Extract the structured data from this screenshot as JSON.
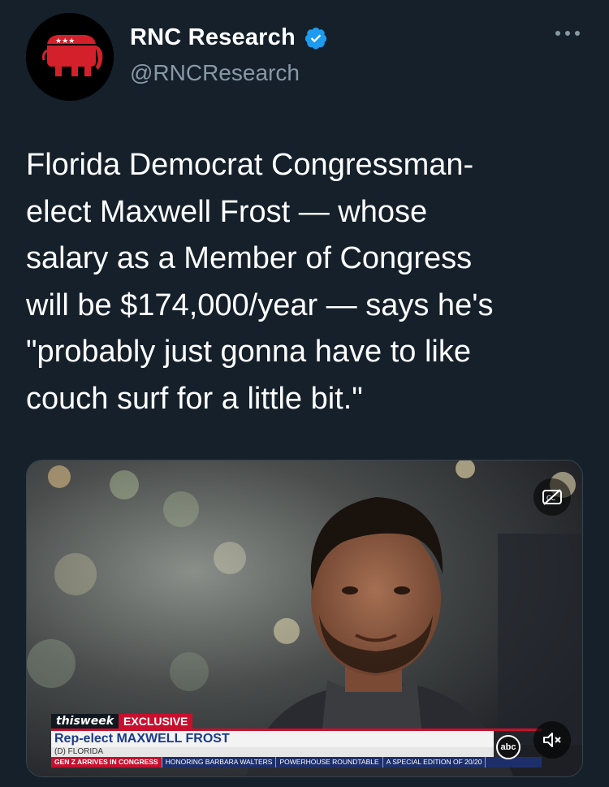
{
  "tweet": {
    "author": {
      "display_name": "RNC Research",
      "handle": "@RNCResearch",
      "verified": true,
      "avatar_icon": "gop-elephant-icon"
    },
    "more_icon": "more-options-icon",
    "text": "Florida Democrat Congressman-\nelect Maxwell Frost — whose\nsalary as a Member of Congress\nwill be $174,000/year — says he's\n\"probably just gonna have to like\ncouch surf for a little bit.\""
  },
  "video": {
    "captions_icon": "captions-off-icon",
    "mute_icon": "muted-speaker-icon",
    "lower_third": {
      "show": "thisweek",
      "tag": "EXCLUSIVE",
      "name": "Rep-elect MAXWELL FROST",
      "subtitle": "(D) FLORIDA",
      "network": "abc",
      "ticker": [
        "GEN Z ARRIVES IN CONGRESS",
        "HONORING BARBARA WALTERS",
        "POWERHOUSE ROUNDTABLE",
        "A SPECIAL EDITION OF 20/20"
      ]
    }
  },
  "colors": {
    "background": "#15202b",
    "text": "#ffffff",
    "secondary": "#8899a6",
    "verified": "#1d9bf0",
    "gop_red": "#d4202a"
  }
}
